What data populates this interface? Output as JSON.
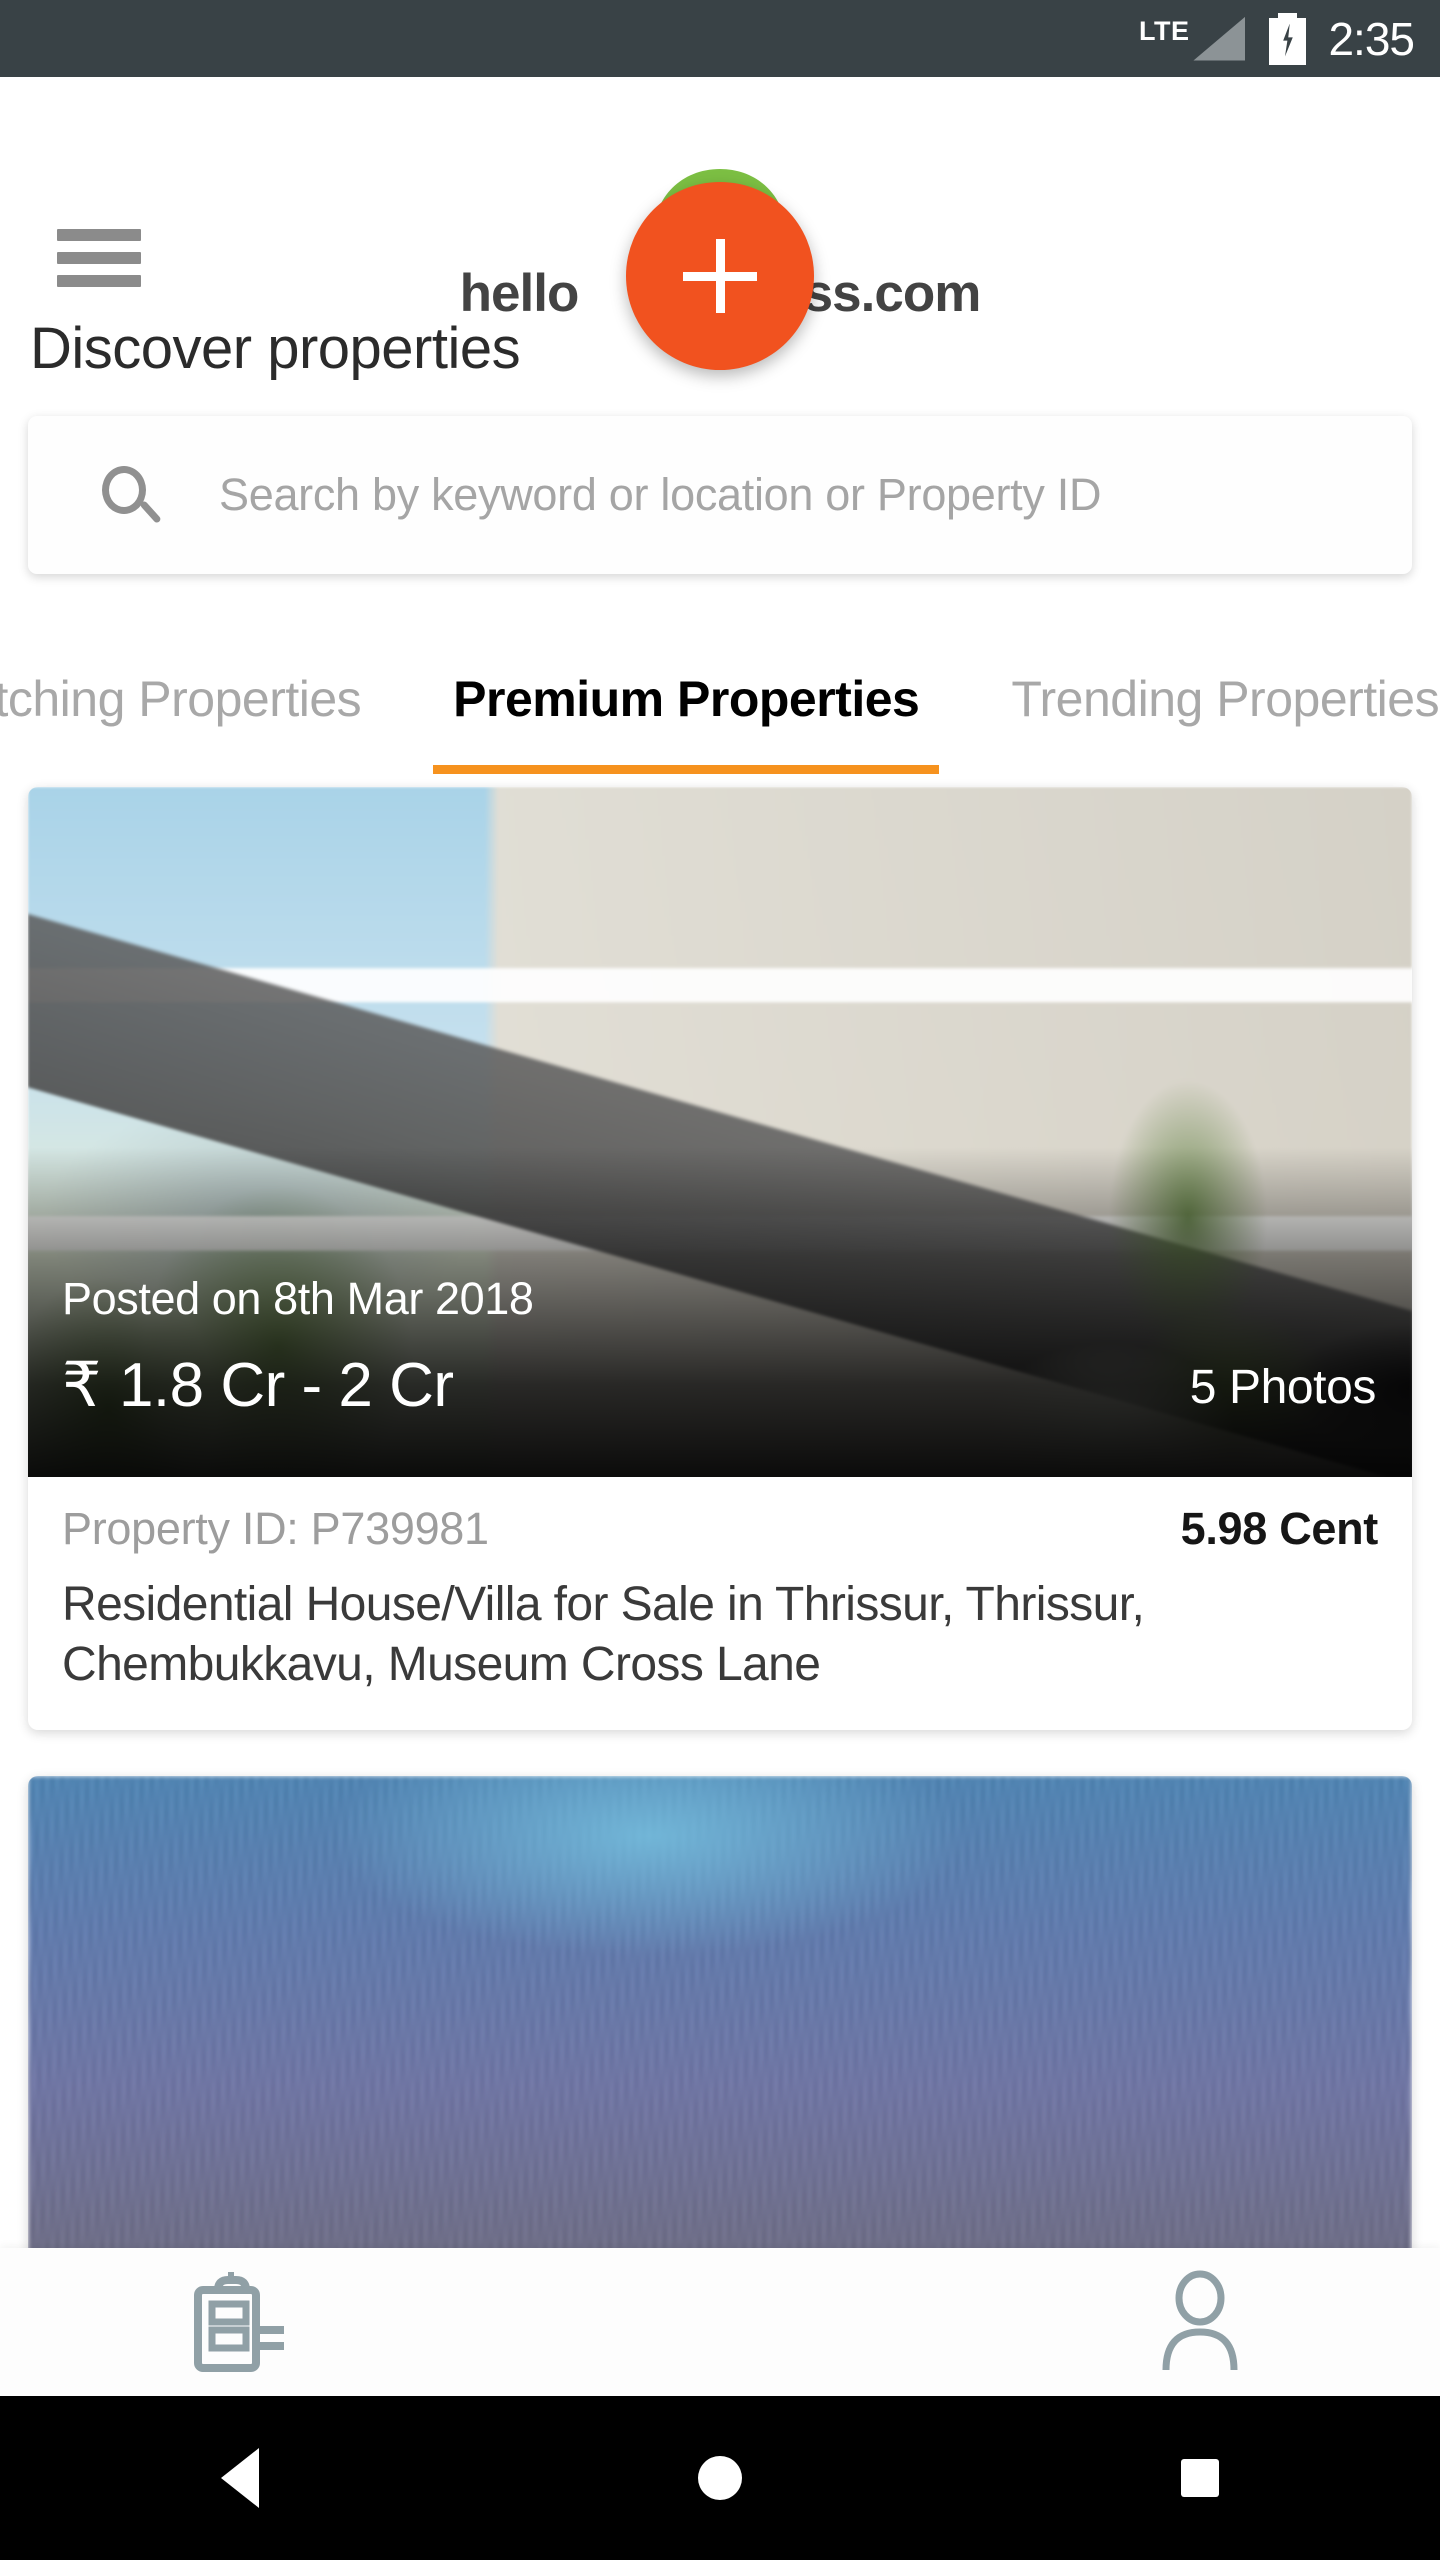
{
  "status_bar": {
    "network_label": "LTE",
    "time": "2:35",
    "battery_state": "charging",
    "background_color": "#394246"
  },
  "header": {
    "menu_icon": "hamburger-menu-icon",
    "logo": {
      "text_left": "hello",
      "text_right": "address.com",
      "pin_icon": "map-pin-house-icon",
      "brand_color": "#7CBF43",
      "text_color": "#434343"
    }
  },
  "page": {
    "title": "Discover properties"
  },
  "search": {
    "icon": "search-icon",
    "placeholder": "Search by keyword or location or Property ID",
    "value": ""
  },
  "tabs": {
    "active_index": 1,
    "accent_color": "#F6921E",
    "items": [
      {
        "label": "Matching Properties",
        "active": false
      },
      {
        "label": "Premium Properties",
        "active": true
      },
      {
        "label": "Trending Properties",
        "active": false
      }
    ]
  },
  "properties": [
    {
      "posted": "Posted on 8th Mar 2018",
      "currency_symbol": "₹",
      "price": "1.8 Cr - 2 Cr",
      "photos_count": "5 Photos",
      "property_id": "Property ID: P739981",
      "area": "5.98 Cent",
      "title": "Residential House/Villa for Sale in Thrissur, Thrissur, Chembukkavu, Museum Cross Lane",
      "image": "modern-white-villa-exterior"
    },
    {
      "image": "lavender-field-landscape"
    }
  ],
  "fab": {
    "icon": "plus-icon",
    "color": "#F1521F"
  },
  "bottom_nav": {
    "items": [
      {
        "icon": "property-listing-icon",
        "active": false
      },
      {
        "icon": "profile-person-icon",
        "active": false
      }
    ]
  },
  "android_nav": {
    "back_icon": "back-triangle-icon",
    "home_icon": "home-circle-icon",
    "recents_icon": "recents-square-icon"
  }
}
